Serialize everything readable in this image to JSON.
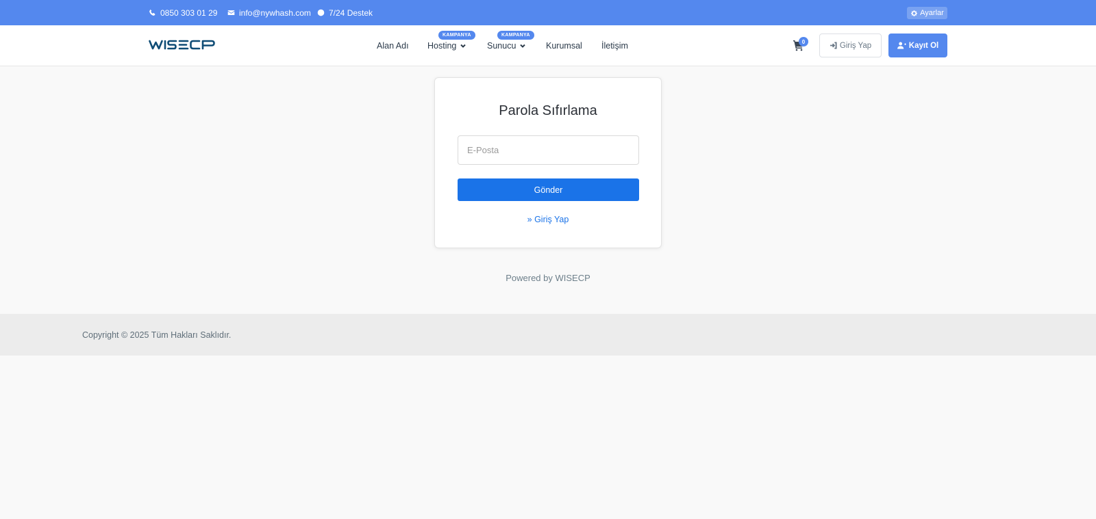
{
  "topbar": {
    "phone": "0850 303 01 29",
    "email": "info@nywhash.com",
    "support": "7/24 Destek",
    "settings_label": "Ayarlar",
    "bg_color": "#5488ee"
  },
  "header": {
    "logo_text": "WISECP",
    "nav": [
      {
        "label": "Alan Adı"
      },
      {
        "label": "Hosting",
        "badge": "KAMPANYA"
      },
      {
        "label": "Sunucu",
        "badge": "KAMPANYA"
      },
      {
        "label": "Kurumsal"
      },
      {
        "label": "İletişim"
      }
    ],
    "cart_count": "0",
    "login_label": "Giriş Yap",
    "register_label": "Kayıt Ol"
  },
  "reset_form": {
    "title": "Parola Sıfırlama",
    "email_placeholder": "E-Posta",
    "email_value": "",
    "submit_label": "Gönder",
    "login_link": "» Giriş Yap"
  },
  "powered_by": "Powered by WISECP",
  "footer": {
    "copyright": "Copyright © 2025 Tüm Hakları Saklıdır."
  },
  "colors": {
    "accent": "#5488ee",
    "primary_button": "#1a73e8",
    "logo": "#0f4c75"
  }
}
